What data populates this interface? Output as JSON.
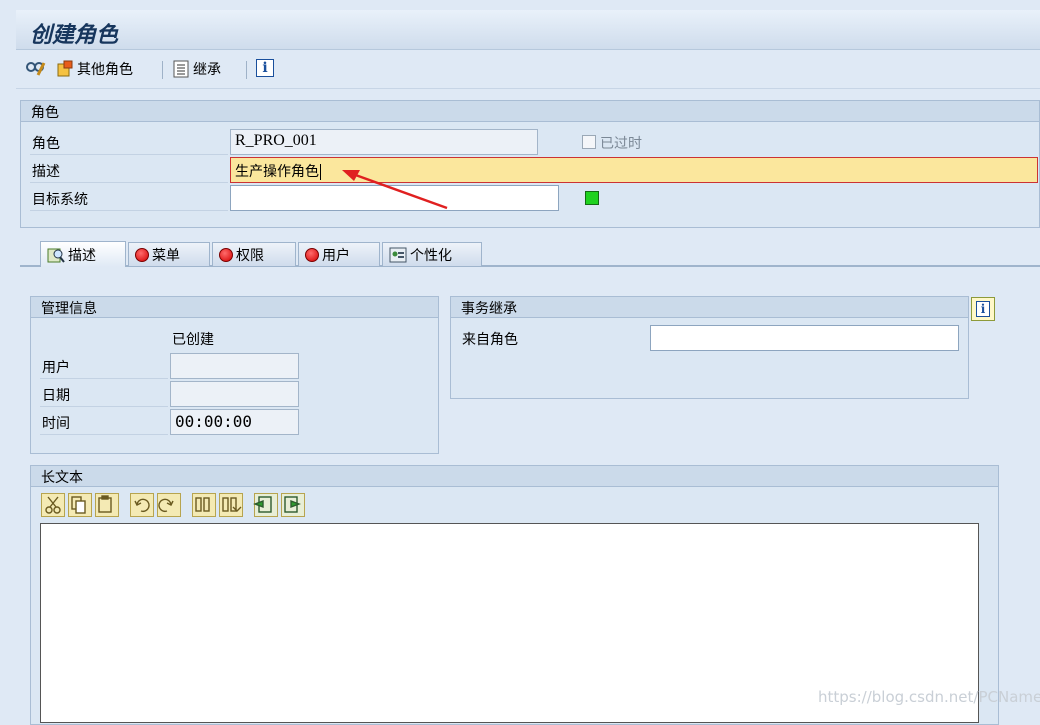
{
  "title": "创建角色",
  "toolbar": {
    "other_roles_label": "其他角色",
    "inherit_label": "继承",
    "info_icon_glyph": "i"
  },
  "role_section": {
    "heading": "角色",
    "role_label": "角色",
    "role_value": "R_PRO_001",
    "expired_label": "已过时",
    "description_label": "描述",
    "description_value": "生产操作角色",
    "target_system_label": "目标系统",
    "target_system_value": ""
  },
  "tabs": [
    {
      "label": "描述",
      "icon": "magnifier-icon",
      "active": true
    },
    {
      "label": "菜单",
      "icon": "red-status-icon"
    },
    {
      "label": "权限",
      "icon": "red-status-icon"
    },
    {
      "label": "用户",
      "icon": "red-status-icon"
    },
    {
      "label": "个性化",
      "icon": "personalization-icon"
    }
  ],
  "admin_info": {
    "heading": "管理信息",
    "created_header": "已创建",
    "user_label": "用户",
    "user_value": "",
    "date_label": "日期",
    "date_value": "",
    "time_label": "时间",
    "time_value": "00:00:00"
  },
  "transaction_inherit": {
    "heading": "事务继承",
    "from_role_label": "来自角色",
    "from_role_value": ""
  },
  "long_text": {
    "heading": "长文本",
    "tools": [
      "cut-icon",
      "copy-icon",
      "paste-icon",
      "undo-icon",
      "redo-icon",
      "find-icon",
      "find-next-icon",
      "import-icon",
      "export-icon"
    ]
  },
  "watermark": "https://blog.csdn.net/PCName",
  "colors": {
    "background": "#dfe9f5",
    "highlight_field": "#fbe79d",
    "status_green": "#1fd21f",
    "status_red": "#d40000",
    "annotation_arrow": "#e02020"
  }
}
